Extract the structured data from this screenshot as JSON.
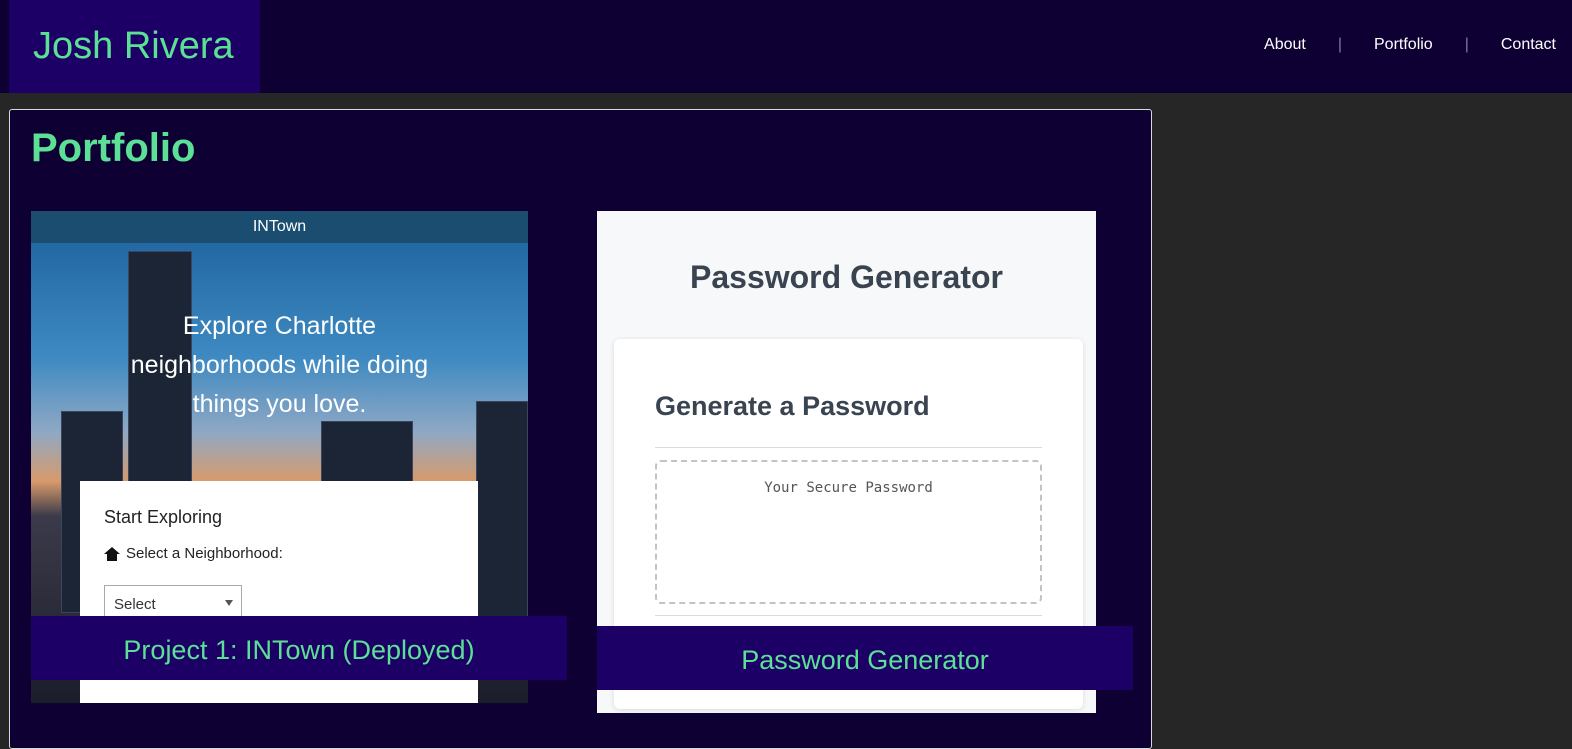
{
  "header": {
    "brand": "Josh Rivera",
    "nav": [
      {
        "label": "About"
      },
      {
        "label": "Portfolio"
      },
      {
        "label": "Contact"
      }
    ],
    "separator": "|"
  },
  "portfolio": {
    "title": "Portfolio",
    "projects": [
      {
        "caption": "Project 1: INTown (Deployed)",
        "preview": {
          "app_bar": "INTown",
          "hero": "Explore Charlotte neighborhoods while doing things you love.",
          "panel_title": "Start Exploring",
          "select_label": "Select a  Neighborhood:",
          "select_value": "Select"
        }
      },
      {
        "caption": "Password Generator",
        "preview": {
          "title": "Password Generator",
          "card_title": "Generate a Password",
          "output_placeholder": "Your Secure Password"
        }
      }
    ]
  },
  "colors": {
    "page_bg": "#262626",
    "header_bg": "#0e0033",
    "brand_bg": "#1d0066",
    "accent": "#5be096",
    "caption_bg": "#1d0066"
  }
}
